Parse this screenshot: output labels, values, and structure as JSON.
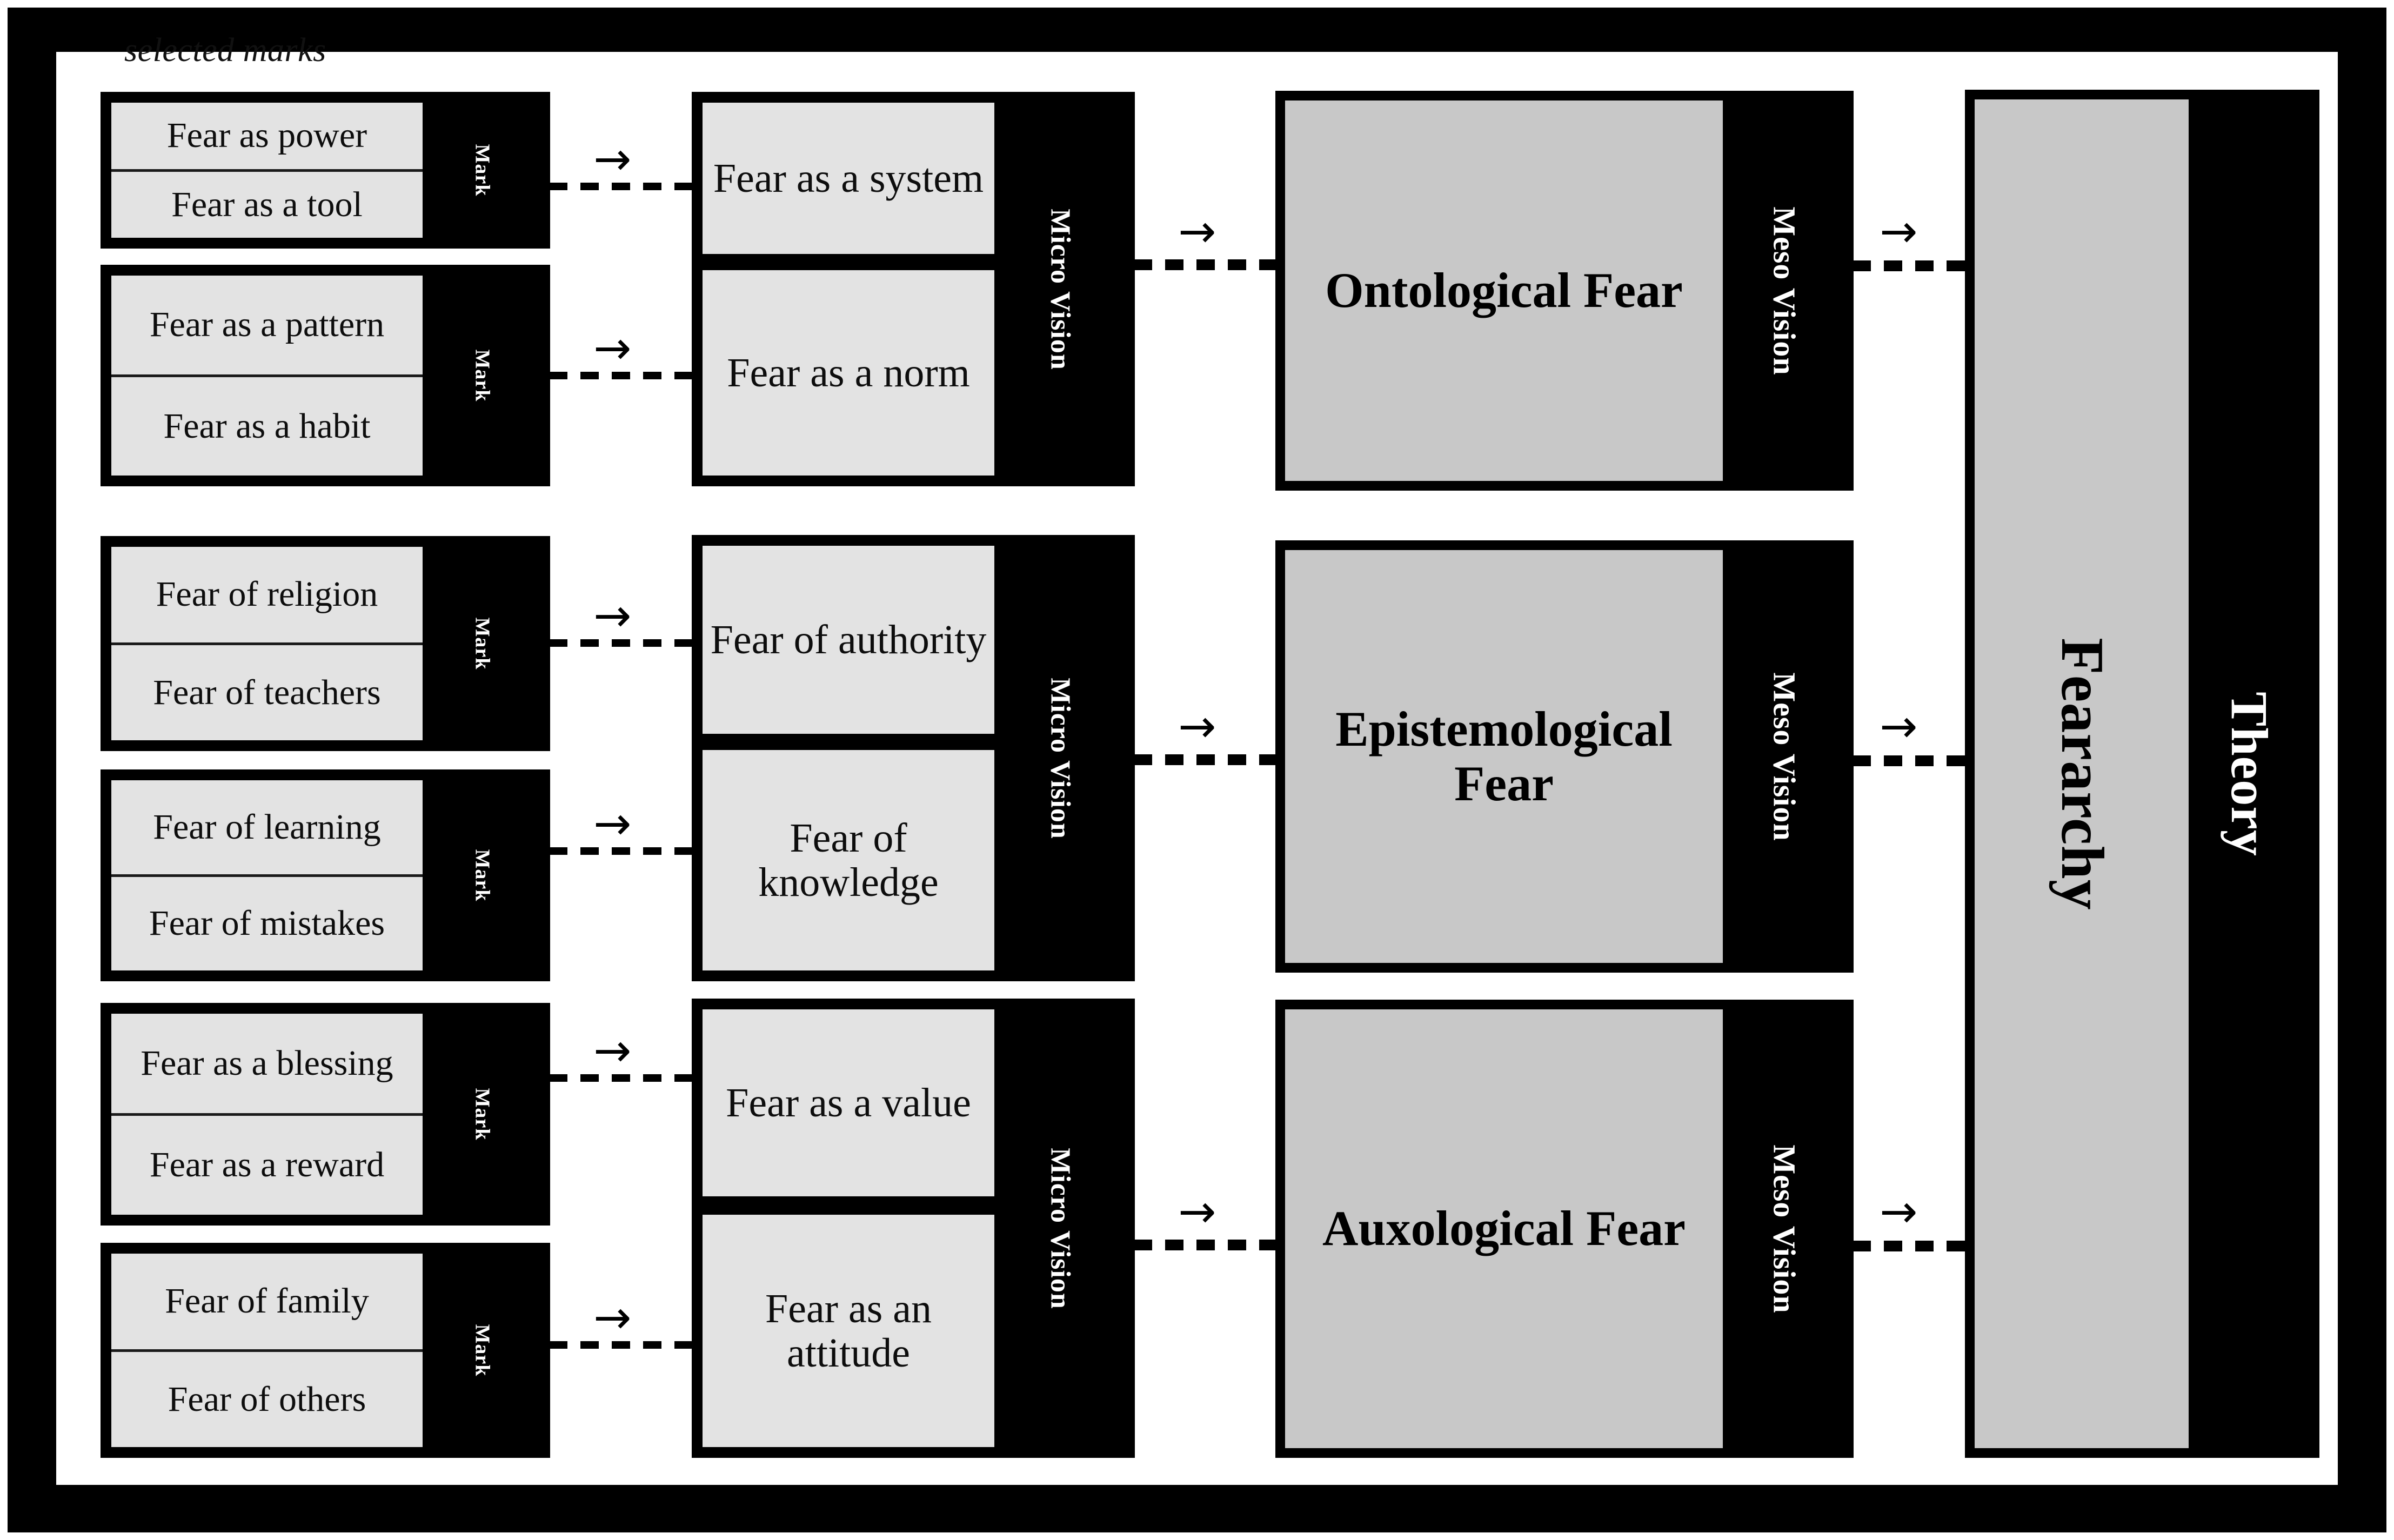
{
  "caption": "selected marks",
  "colors": {
    "frame": "#000000",
    "mark_cell_gray": "#e3e3e3",
    "meso_block_gray": "#c8c8c8",
    "text": "#000000",
    "label_text": "#ffffff"
  },
  "labels": {
    "mark": "Mark",
    "micro_vision": "Micro Vision",
    "meso_vision": "Meso Vision",
    "feararchy": "Feararchy",
    "theory": "Theory",
    "arrow": "→"
  },
  "marks": [
    {
      "id": "mark-1",
      "items": [
        "Fear as power",
        "Fear as a tool"
      ]
    },
    {
      "id": "mark-2",
      "items": [
        "Fear as a pattern",
        "Fear as a habit"
      ]
    },
    {
      "id": "mark-3",
      "items": [
        "Fear of religion",
        "Fear of teachers"
      ]
    },
    {
      "id": "mark-4",
      "items": [
        "Fear of learning",
        "Fear of mistakes"
      ]
    },
    {
      "id": "mark-5",
      "items": [
        "Fear as a blessing",
        "Fear as a reward"
      ]
    },
    {
      "id": "mark-6",
      "items": [
        "Fear of family",
        "Fear of others"
      ]
    }
  ],
  "micro_groups": [
    {
      "id": "micro-1",
      "panes": [
        "Fear as a system",
        "Fear as a norm"
      ]
    },
    {
      "id": "micro-2",
      "panes": [
        "Fear of authority",
        "Fear of knowledge"
      ]
    },
    {
      "id": "micro-3",
      "panes": [
        "Fear as a value",
        "Fear as an attitude"
      ]
    }
  ],
  "meso_groups": [
    {
      "id": "meso-1",
      "title": "Ontological Fear"
    },
    {
      "id": "meso-2",
      "title": "Epistemological Fear"
    },
    {
      "id": "meso-3",
      "title": "Auxological Fear"
    }
  ],
  "theory": {
    "gray_label": "Feararchy",
    "black_label": "Theory"
  }
}
